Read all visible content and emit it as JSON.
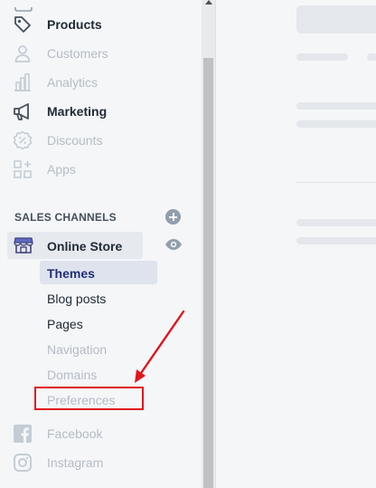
{
  "sidebar": {
    "items": [
      {
        "label": "Products",
        "icon": "tag-icon",
        "state": "strong"
      },
      {
        "label": "Customers",
        "icon": "person-icon",
        "state": "muted"
      },
      {
        "label": "Analytics",
        "icon": "bar-chart-icon",
        "state": "muted"
      },
      {
        "label": "Marketing",
        "icon": "megaphone-icon",
        "state": "strong"
      },
      {
        "label": "Discounts",
        "icon": "discount-badge-icon",
        "state": "muted"
      },
      {
        "label": "Apps",
        "icon": "apps-grid-icon",
        "state": "muted"
      }
    ],
    "sales_channels": {
      "heading": "SALES CHANNELS",
      "add_icon": "plus-circle-icon",
      "online_store": {
        "label": "Online Store",
        "icon": "storefront-icon",
        "view_icon": "eye-icon",
        "subitems": [
          {
            "label": "Themes",
            "state": "active"
          },
          {
            "label": "Blog posts",
            "state": "normal"
          },
          {
            "label": "Pages",
            "state": "normal"
          },
          {
            "label": "Navigation",
            "state": "muted"
          },
          {
            "label": "Domains",
            "state": "muted"
          },
          {
            "label": "Preferences",
            "state": "muted"
          }
        ]
      },
      "channels": [
        {
          "label": "Facebook",
          "icon": "facebook-icon"
        },
        {
          "label": "Instagram",
          "icon": "instagram-icon"
        }
      ]
    }
  },
  "colors": {
    "sidebar_bg": "#f4f6f8",
    "active_text": "#202e78",
    "muted_text": "#b5bcc4",
    "annotation_red": "#e0151c"
  }
}
